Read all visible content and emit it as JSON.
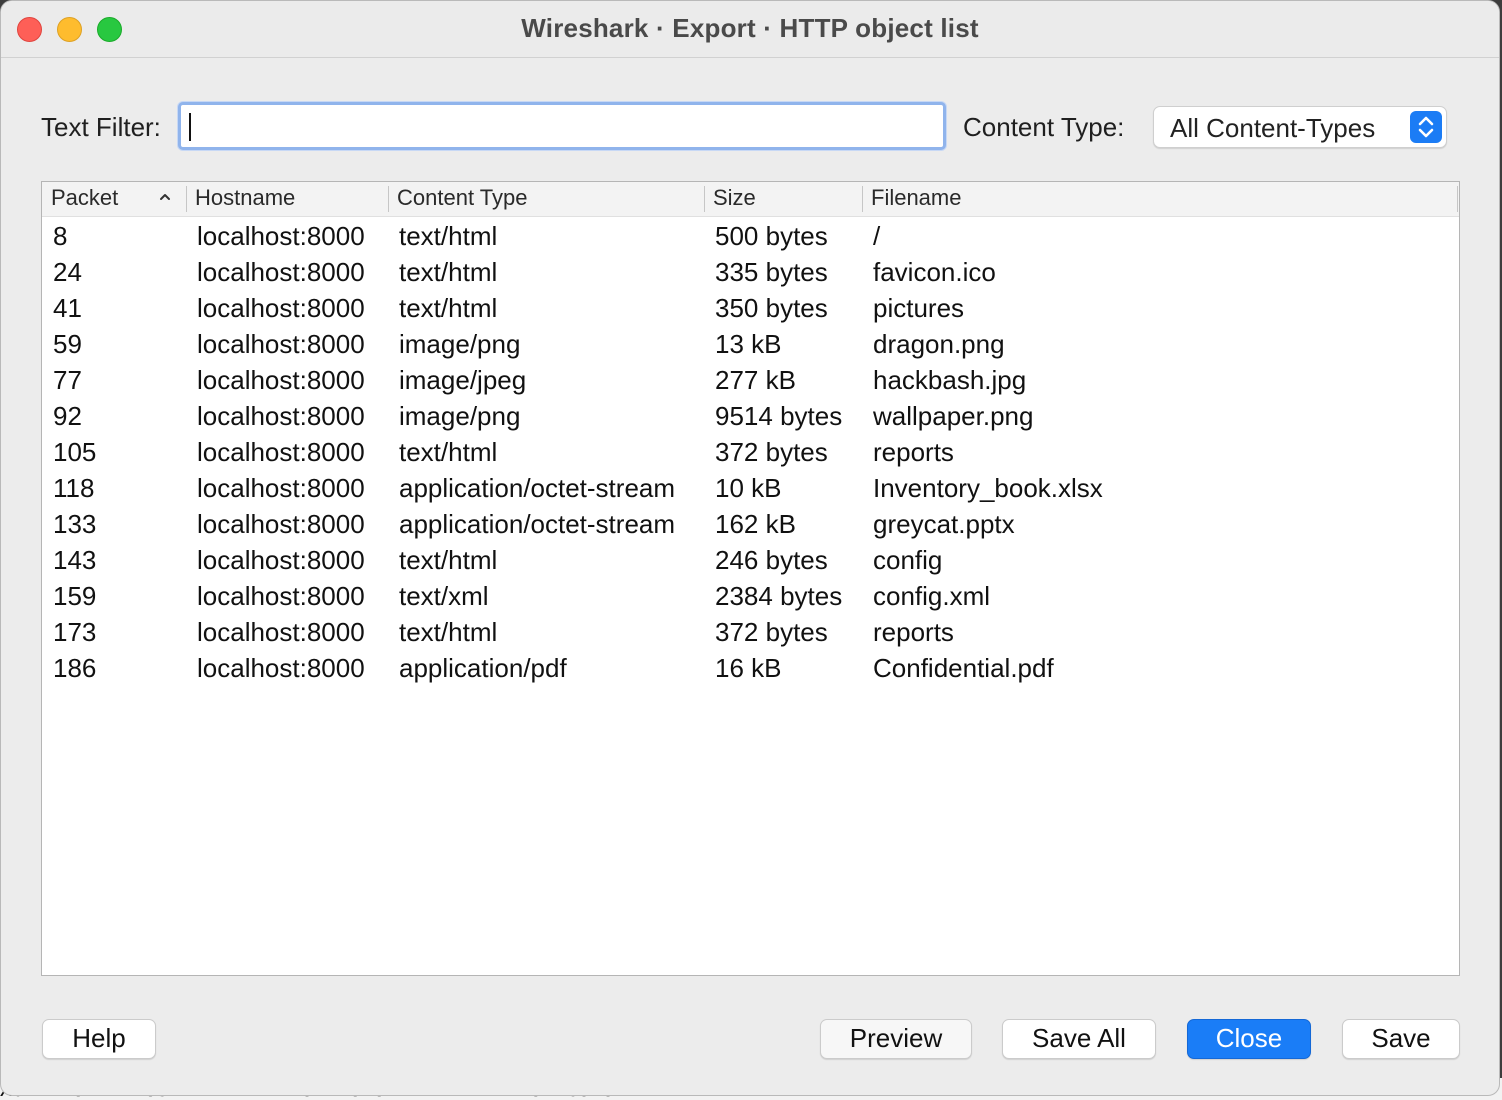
{
  "window": {
    "title": "Wireshark · Export · HTTP object list"
  },
  "filter": {
    "text_filter_label": "Text Filter:",
    "text_filter_value": "",
    "content_type_label": "Content Type:",
    "content_type_selected": "All Content-Types"
  },
  "table": {
    "columns": [
      "Packet",
      "Hostname",
      "Content Type",
      "Size",
      "Filename"
    ],
    "sort_column": "Packet",
    "sort_direction": "ascending",
    "rows": [
      {
        "packet": "8",
        "hostname": "localhost:8000",
        "content_type": "text/html",
        "size": "500 bytes",
        "filename": "/"
      },
      {
        "packet": "24",
        "hostname": "localhost:8000",
        "content_type": "text/html",
        "size": "335 bytes",
        "filename": "favicon.ico"
      },
      {
        "packet": "41",
        "hostname": "localhost:8000",
        "content_type": "text/html",
        "size": "350 bytes",
        "filename": "pictures"
      },
      {
        "packet": "59",
        "hostname": "localhost:8000",
        "content_type": "image/png",
        "size": "13 kB",
        "filename": "dragon.png"
      },
      {
        "packet": "77",
        "hostname": "localhost:8000",
        "content_type": "image/jpeg",
        "size": "277 kB",
        "filename": "hackbash.jpg"
      },
      {
        "packet": "92",
        "hostname": "localhost:8000",
        "content_type": "image/png",
        "size": "9514 bytes",
        "filename": "wallpaper.png"
      },
      {
        "packet": "105",
        "hostname": "localhost:8000",
        "content_type": "text/html",
        "size": "372 bytes",
        "filename": "reports"
      },
      {
        "packet": "118",
        "hostname": "localhost:8000",
        "content_type": "application/octet-stream",
        "size": "10 kB",
        "filename": "Inventory_book.xlsx"
      },
      {
        "packet": "133",
        "hostname": "localhost:8000",
        "content_type": "application/octet-stream",
        "size": "162 kB",
        "filename": "greycat.pptx"
      },
      {
        "packet": "143",
        "hostname": "localhost:8000",
        "content_type": "text/html",
        "size": "246 bytes",
        "filename": "config"
      },
      {
        "packet": "159",
        "hostname": "localhost:8000",
        "content_type": "text/xml",
        "size": "2384 bytes",
        "filename": "config.xml"
      },
      {
        "packet": "173",
        "hostname": "localhost:8000",
        "content_type": "text/html",
        "size": "372 bytes",
        "filename": "reports"
      },
      {
        "packet": "186",
        "hostname": "localhost:8000",
        "content_type": "application/pdf",
        "size": "16 kB",
        "filename": "Confidential.pdf"
      }
    ]
  },
  "buttons": {
    "help": "Help",
    "preview": "Preview",
    "save_all": "Save All",
    "close": "Close",
    "save": "Save"
  },
  "background_terminal": {
    "text": "X047 AUDTEWEUS1177.1.7. IU VAUTUA. LIKE VELKU7 CUTU"
  },
  "colors": {
    "accent": "#1a7df7",
    "focus_ring": "#90b4ec",
    "close_light": "#fe5f57",
    "minimize_light": "#febc2e",
    "zoom_light": "#28c840"
  },
  "icons": {
    "sort": "chevron-up-icon",
    "select": "up-down-chevron-icon"
  }
}
